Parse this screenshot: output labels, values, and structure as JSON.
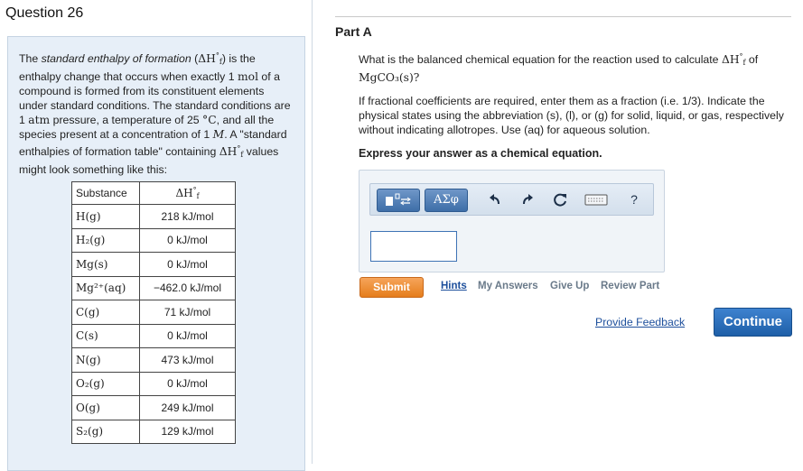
{
  "question": {
    "title": "Question 26"
  },
  "intro": {
    "t1": "The ",
    "t2_italic": "standard enthalpy of formation",
    "t3": " (",
    "delta_h": "ΔH",
    "sub_f": "f",
    "sup_deg": "°",
    "t4": ") is the enthalpy change that occurs when exactly 1 ",
    "mol": "mol",
    "t5": " of a compound is formed from its constituent elements under standard conditions. The standard conditions are 1 ",
    "atm": "atm",
    "t6": " pressure, a temperature of 25 ",
    "degC": "°C",
    "t7": ", and all the species present at a concentration of 1 ",
    "molarity": "M",
    "t8": ". A \"standard enthalpies of formation table\" containing ",
    "t9": " values might look something like this:"
  },
  "table": {
    "headers": {
      "substance": "Substance",
      "delta_h": "ΔH",
      "sub_f": "f",
      "sup_deg": "°"
    },
    "rows": [
      {
        "substance": "H(g)",
        "value": "218 kJ/mol"
      },
      {
        "substance": "H₂(g)",
        "value": "0 kJ/mol"
      },
      {
        "substance": "Mg(s)",
        "value": "0 kJ/mol"
      },
      {
        "substance": "Mg²⁺(aq)",
        "value": "−462.0 kJ/mol"
      },
      {
        "substance": "C(g)",
        "value": "71 kJ/mol"
      },
      {
        "substance": "C(s)",
        "value": "0 kJ/mol"
      },
      {
        "substance": "N(g)",
        "value": "473 kJ/mol"
      },
      {
        "substance": "O₂(g)",
        "value": "0 kJ/mol"
      },
      {
        "substance": "O(g)",
        "value": "249 kJ/mol"
      },
      {
        "substance": "S₂(g)",
        "value": "129 kJ/mol"
      }
    ]
  },
  "part": {
    "label": "Part A",
    "question_text": "What is the balanced chemical equation for the reaction used to calculate ",
    "question_delta": "ΔH",
    "question_sub": "f",
    "question_sup": "°",
    "question_of": " of",
    "question_compound": "MgCO₃(s)?",
    "instructions": "If fractional coefficients are required, enter them as a fraction (i.e. 1/3). Indicate the physical states using the abbreviation (s), (l), or (g) for solid, liquid, or gas, respectively without indicating allotropes. Use (aq) for aqueous solution.",
    "express": "Express your answer as a chemical equation."
  },
  "toolbar": {
    "greek_label": "ΑΣφ",
    "help_label": "?"
  },
  "answer": {
    "value": ""
  },
  "actions": {
    "submit": "Submit",
    "hints": "Hints",
    "my_answers": "My Answers",
    "give_up": "Give Up",
    "review_part": "Review Part",
    "provide_feedback": "Provide Feedback",
    "continue": "Continue"
  },
  "colors": {
    "submit": "#e8821f",
    "continue": "#2a6db9",
    "link": "#1d4f9c",
    "panel": "#e7eff8"
  }
}
